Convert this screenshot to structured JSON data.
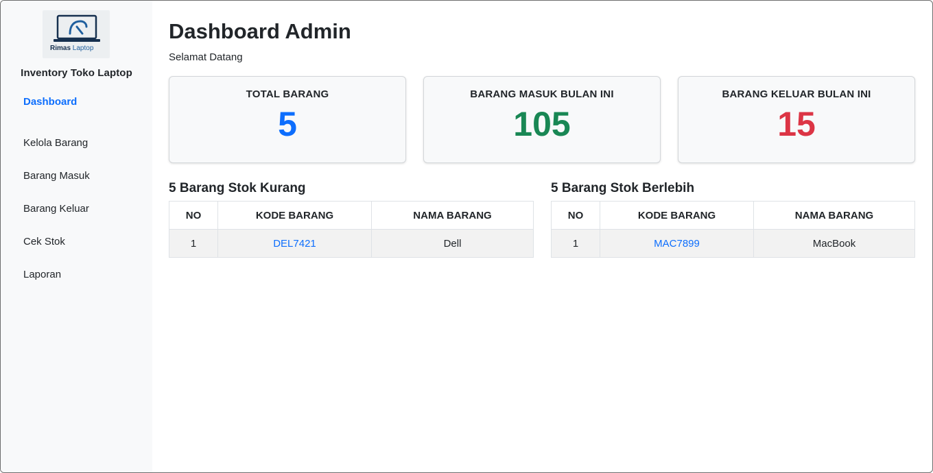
{
  "sidebar": {
    "logo": {
      "name": "Rimas",
      "suffix": "Laptop"
    },
    "brand": "Inventory Toko Laptop",
    "items": [
      {
        "label": "Dashboard",
        "active": true
      },
      {
        "label": "Kelola Barang"
      },
      {
        "label": "Barang Masuk"
      },
      {
        "label": "Barang Keluar"
      },
      {
        "label": "Cek Stok"
      },
      {
        "label": "Laporan"
      }
    ]
  },
  "header": {
    "title": "Dashboard Admin",
    "subtitle": "Selamat Datang"
  },
  "cards": [
    {
      "label": "TOTAL BARANG",
      "value": "5",
      "color": "#0d6efd"
    },
    {
      "label": "BARANG MASUK BULAN INI",
      "value": "105",
      "color": "#198754"
    },
    {
      "label": "BARANG KELUAR BULAN INI",
      "value": "15",
      "color": "#dc3545"
    }
  ],
  "tables": {
    "columns": [
      "NO",
      "KODE BARANG",
      "NAMA BARANG"
    ],
    "low_stock": {
      "title": "5 Barang Stok Kurang",
      "rows": [
        {
          "no": "1",
          "kode": "DEL7421",
          "nama": "Dell"
        }
      ]
    },
    "over_stock": {
      "title": "5 Barang Stok Berlebih",
      "rows": [
        {
          "no": "1",
          "kode": "MAC7899",
          "nama": "MacBook"
        }
      ]
    }
  },
  "colors": {
    "accent": "#0d6efd",
    "success": "#198754",
    "danger": "#dc3545",
    "sidebar_bg": "#f8f9fa"
  }
}
